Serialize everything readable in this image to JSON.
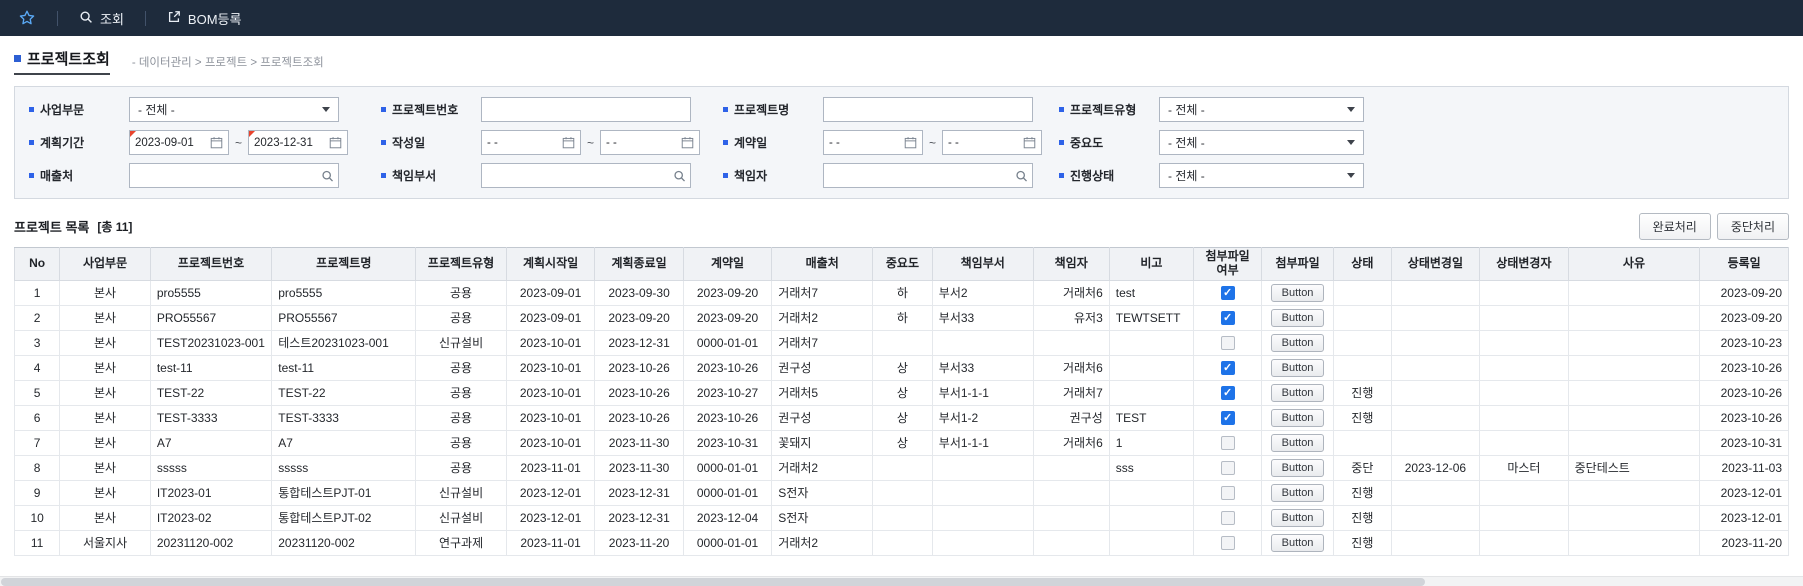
{
  "topbar": {
    "search_label": "조회",
    "bom_label": "BOM등록"
  },
  "page": {
    "title": "프로젝트조회",
    "breadcrumb": "- 데이터관리 > 프로젝트 > 프로젝트조회"
  },
  "filters": {
    "business_division": {
      "label": "사업부문",
      "value": "- 전체 -"
    },
    "project_no": {
      "label": "프로젝트번호",
      "value": ""
    },
    "project_name": {
      "label": "프로젝트명",
      "value": ""
    },
    "project_type": {
      "label": "프로젝트유형",
      "value": "- 전체 -"
    },
    "plan_period": {
      "label": "계획기간",
      "from": "2023-09-01",
      "to": "2023-12-31",
      "separator": "~"
    },
    "created_date": {
      "label": "작성일",
      "from": "- -",
      "to": "- -",
      "separator": "~"
    },
    "contract_date": {
      "label": "계약일",
      "from": "- -",
      "to": "- -",
      "separator": "~"
    },
    "importance": {
      "label": "중요도",
      "value": "- 전체 -"
    },
    "customer": {
      "label": "매출처",
      "value": ""
    },
    "dept": {
      "label": "책임부서",
      "value": ""
    },
    "manager": {
      "label": "책임자",
      "value": ""
    },
    "progress_status": {
      "label": "진행상태",
      "value": "- 전체 -"
    }
  },
  "list": {
    "title": "프로젝트 목록",
    "count_label": "[총 11]",
    "complete_button": "완료처리",
    "suspend_button": "중단처리"
  },
  "table": {
    "columns": [
      "No",
      "사업부문",
      "프로젝트번호",
      "프로젝트명",
      "프로젝트유형",
      "계획시작일",
      "계획종료일",
      "계약일",
      "매출처",
      "중요도",
      "책임부서",
      "책임자",
      "비고",
      "첨부파일\n여부",
      "첨부파일",
      "상태",
      "상태변경일",
      "상태변경자",
      "사유",
      "등록일"
    ],
    "rows": [
      {
        "no": "1",
        "division": "본사",
        "project_no": "pro5555",
        "project_name": "pro5555",
        "project_type": "공용",
        "plan_start": "2023-09-01",
        "plan_end": "2023-09-30",
        "contract_date": "2023-09-20",
        "customer": "거래처7",
        "importance": "하",
        "dept": "부서2",
        "manager": "거래처6",
        "note": "test",
        "has_attachment": true,
        "attachment_button": "Button",
        "status": "",
        "status_change_date": "",
        "status_changer": "",
        "reason": "",
        "reg_date": "2023-09-20"
      },
      {
        "no": "2",
        "division": "본사",
        "project_no": "PRO55567",
        "project_name": "PRO55567",
        "project_type": "공용",
        "plan_start": "2023-09-01",
        "plan_end": "2023-09-20",
        "contract_date": "2023-09-20",
        "customer": "거래처2",
        "importance": "하",
        "dept": "부서33",
        "manager": "유저3",
        "note": "TEWTSETT",
        "has_attachment": true,
        "attachment_button": "Button",
        "status": "",
        "status_change_date": "",
        "status_changer": "",
        "reason": "",
        "reg_date": "2023-09-20"
      },
      {
        "no": "3",
        "division": "본사",
        "project_no": "TEST20231023-001",
        "project_name": "테스트20231023-001",
        "project_type": "신규설비",
        "plan_start": "2023-10-01",
        "plan_end": "2023-12-31",
        "contract_date": "0000-01-01",
        "customer": "거래처7",
        "importance": "",
        "dept": "",
        "manager": "",
        "note": "",
        "has_attachment": false,
        "attachment_button": "Button",
        "status": "",
        "status_change_date": "",
        "status_changer": "",
        "reason": "",
        "reg_date": "2023-10-23"
      },
      {
        "no": "4",
        "division": "본사",
        "project_no": "test-11",
        "project_name": "test-11",
        "project_type": "공용",
        "plan_start": "2023-10-01",
        "plan_end": "2023-10-26",
        "contract_date": "2023-10-26",
        "customer": "권구성",
        "importance": "상",
        "dept": "부서33",
        "manager": "거래처6",
        "note": "",
        "has_attachment": true,
        "attachment_button": "Button",
        "status": "",
        "status_change_date": "",
        "status_changer": "",
        "reason": "",
        "reg_date": "2023-10-26"
      },
      {
        "no": "5",
        "division": "본사",
        "project_no": "TEST-22",
        "project_name": "TEST-22",
        "project_type": "공용",
        "plan_start": "2023-10-01",
        "plan_end": "2023-10-26",
        "contract_date": "2023-10-27",
        "customer": "거래처5",
        "importance": "상",
        "dept": "부서1-1-1",
        "manager": "거래처7",
        "note": "",
        "has_attachment": true,
        "attachment_button": "Button",
        "status": "진행",
        "status_change_date": "",
        "status_changer": "",
        "reason": "",
        "reg_date": "2023-10-26"
      },
      {
        "no": "6",
        "division": "본사",
        "project_no": "TEST-3333",
        "project_name": "TEST-3333",
        "project_type": "공용",
        "plan_start": "2023-10-01",
        "plan_end": "2023-10-26",
        "contract_date": "2023-10-26",
        "customer": "권구성",
        "importance": "상",
        "dept": "부서1-2",
        "manager": "권구성",
        "note": "TEST",
        "has_attachment": true,
        "attachment_button": "Button",
        "status": "진행",
        "status_change_date": "",
        "status_changer": "",
        "reason": "",
        "reg_date": "2023-10-26"
      },
      {
        "no": "7",
        "division": "본사",
        "project_no": "A7",
        "project_name": "A7",
        "project_type": "공용",
        "plan_start": "2023-10-01",
        "plan_end": "2023-11-30",
        "contract_date": "2023-10-31",
        "customer": "꽃돼지",
        "importance": "상",
        "dept": "부서1-1-1",
        "manager": "거래처6",
        "note": "1",
        "has_attachment": false,
        "attachment_button": "Button",
        "status": "",
        "status_change_date": "",
        "status_changer": "",
        "reason": "",
        "reg_date": "2023-10-31"
      },
      {
        "no": "8",
        "division": "본사",
        "project_no": "sssss",
        "project_name": "sssss",
        "project_type": "공용",
        "plan_start": "2023-11-01",
        "plan_end": "2023-11-30",
        "contract_date": "0000-01-01",
        "customer": "거래처2",
        "importance": "",
        "dept": "",
        "manager": "",
        "note": "sss",
        "has_attachment": false,
        "attachment_button": "Button",
        "status": "중단",
        "status_change_date": "2023-12-06",
        "status_changer": "마스터",
        "reason": "중단테스트",
        "reg_date": "2023-11-03"
      },
      {
        "no": "9",
        "division": "본사",
        "project_no": "IT2023-01",
        "project_name": "통합테스트PJT-01",
        "project_type": "신규설비",
        "plan_start": "2023-12-01",
        "plan_end": "2023-12-31",
        "contract_date": "0000-01-01",
        "customer": "S전자",
        "importance": "",
        "dept": "",
        "manager": "",
        "note": "",
        "has_attachment": false,
        "attachment_button": "Button",
        "status": "진행",
        "status_change_date": "",
        "status_changer": "",
        "reason": "",
        "reg_date": "2023-12-01"
      },
      {
        "no": "10",
        "division": "본사",
        "project_no": "IT2023-02",
        "project_name": "통합테스트PJT-02",
        "project_type": "신규설비",
        "plan_start": "2023-12-01",
        "plan_end": "2023-12-31",
        "contract_date": "2023-12-04",
        "customer": "S전자",
        "importance": "",
        "dept": "",
        "manager": "",
        "note": "",
        "has_attachment": false,
        "attachment_button": "Button",
        "status": "진행",
        "status_change_date": "",
        "status_changer": "",
        "reason": "",
        "reg_date": "2023-12-01"
      },
      {
        "no": "11",
        "division": "서울지사",
        "project_no": "20231120-002",
        "project_name": "20231120-002",
        "project_type": "연구과제",
        "plan_start": "2023-11-01",
        "plan_end": "2023-11-20",
        "contract_date": "0000-01-01",
        "customer": "거래처2",
        "importance": "",
        "dept": "",
        "manager": "",
        "note": "",
        "has_attachment": false,
        "attachment_button": "Button",
        "status": "진행",
        "status_change_date": "",
        "status_changer": "",
        "reason": "",
        "reg_date": "2023-11-20"
      }
    ]
  },
  "colors": {
    "topbar_bg": "#1e2b3c",
    "accent_blue": "#2e62e8",
    "checkbox_checked": "#1e73e8",
    "panel_bg": "#f4f6f9"
  }
}
